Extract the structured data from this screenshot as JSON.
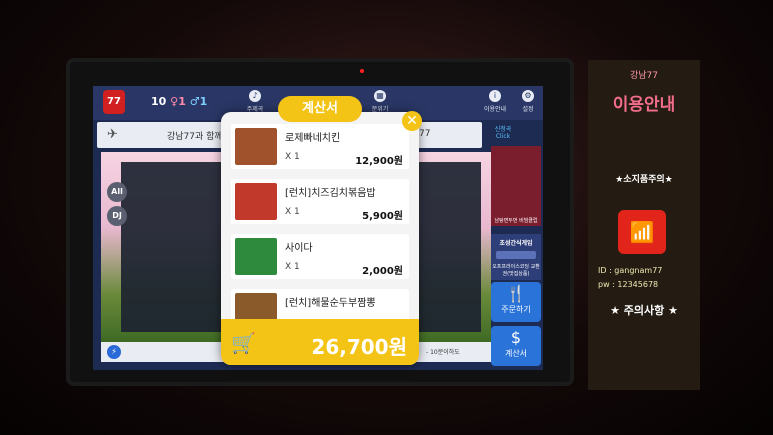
{
  "topbar": {
    "logo": "77",
    "room_number": "10",
    "female_count": "♀1",
    "male_count": "♂1",
    "icons": [
      {
        "label": "주제곡",
        "icon": "music-icon"
      },
      {
        "label": "분위기",
        "icon": "mood-icon"
      },
      {
        "label": "이용안내",
        "icon": "info-icon"
      },
      {
        "label": "설정",
        "icon": "gear-icon"
      }
    ]
  },
  "search": {
    "text_left": "강남77과 함께",
    "text_right": "77"
  },
  "sidebar": {
    "all": "All",
    "dj": "DJ"
  },
  "right_panel": {
    "promo_tag": "신청곡 Click",
    "promo_caption": "남탕면두번 비빔클럽",
    "game_title": "초성간식게임",
    "game_caption": "오프프라이스코딩 교환권(맛집상품)",
    "order_label": "주문하기",
    "bill_label": "계산서"
  },
  "bottom": {
    "note": "- 10분이하도"
  },
  "modal": {
    "title": "계산서",
    "close": "✕",
    "items": [
      {
        "name": "로제빠네치킨",
        "qty": "X 1",
        "price": "12,900원",
        "color": "#a0522d"
      },
      {
        "name": "[런치]치즈김치볶음밥",
        "qty": "X 1",
        "price": "5,900원",
        "color": "#c0392b"
      },
      {
        "name": "사이다",
        "qty": "X 1",
        "price": "2,000원",
        "color": "#2e8b3e"
      },
      {
        "name": "[런치]해물순두부짬뽕",
        "qty": "",
        "price": "",
        "color": "#8b5a2b"
      }
    ],
    "total": "26,700원"
  },
  "poster": {
    "sub": "강남77",
    "head": "이용안내",
    "warn": "★소지품주의★",
    "wifi": "wifi-icon",
    "id": "ID : gangnam77",
    "pw": "pw : 12345678",
    "caution": "★ 주의사항 ★"
  }
}
